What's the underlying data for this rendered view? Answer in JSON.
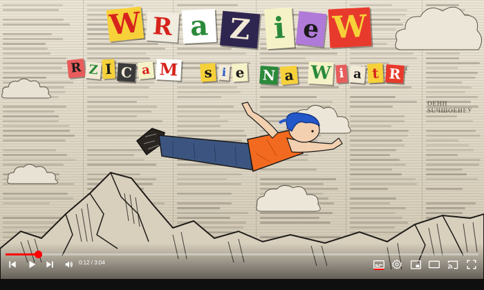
{
  "video": {
    "title_word_letters": [
      "W",
      "R",
      "a",
      "Z",
      "i",
      "e",
      "W"
    ],
    "subtitle_letters": [
      "R",
      "Z",
      "I",
      "C",
      "a",
      "M",
      "s",
      "i",
      "e",
      "N",
      "a",
      "W",
      "i",
      "a",
      "t",
      "R"
    ]
  },
  "player": {
    "progress_fraction": 0.069,
    "time": {
      "current": "0:12",
      "separator": " / ",
      "duration": "3:04"
    },
    "icons": {
      "previous": "skip-previous-icon",
      "play": "play-icon",
      "next": "skip-next-icon",
      "volume": "volume-icon",
      "subtitles": "subtitles-icon",
      "settings": "gear-icon",
      "miniplayer": "miniplayer-icon",
      "theater": "theater-mode-icon",
      "cast": "cast-icon",
      "fullscreen": "fullscreen-icon"
    },
    "colors": {
      "accent": "#ff0000",
      "icon": "#ffffff"
    }
  }
}
